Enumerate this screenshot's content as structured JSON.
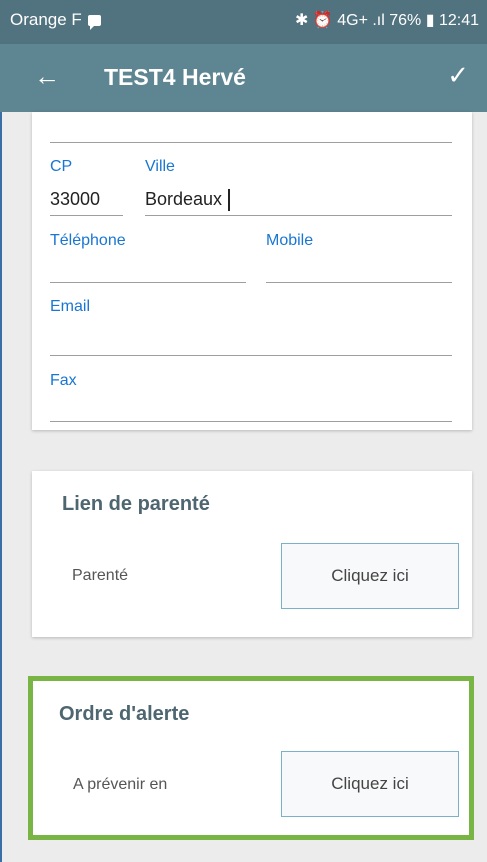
{
  "status_bar": {
    "carrier": "Orange F",
    "indicators": "✱ ⏰ 4G+ .ıl 76% ▮ 12:41"
  },
  "app_bar": {
    "back_icon": "←",
    "title": "TEST4 Hervé",
    "confirm_icon": "✓"
  },
  "contact": {
    "cp": {
      "label": "CP",
      "value": "33000"
    },
    "ville": {
      "label": "Ville",
      "value": "Bordeaux"
    },
    "telephone": {
      "label": "Téléphone",
      "value": ""
    },
    "mobile": {
      "label": "Mobile",
      "value": ""
    },
    "email": {
      "label": "Email",
      "value": ""
    },
    "fax": {
      "label": "Fax",
      "value": ""
    }
  },
  "lien_parente": {
    "title": "Lien de parenté",
    "row_label": "Parenté",
    "button": "Cliquez ici"
  },
  "ordre_alerte": {
    "title": "Ordre d'alerte",
    "row_label": "A prévenir en",
    "button": "Cliquez ici",
    "highlight_color": "#78b545"
  },
  "colors": {
    "status_bar": "#51727f",
    "app_bar": "#5e8592",
    "field_label": "#1976d2"
  }
}
